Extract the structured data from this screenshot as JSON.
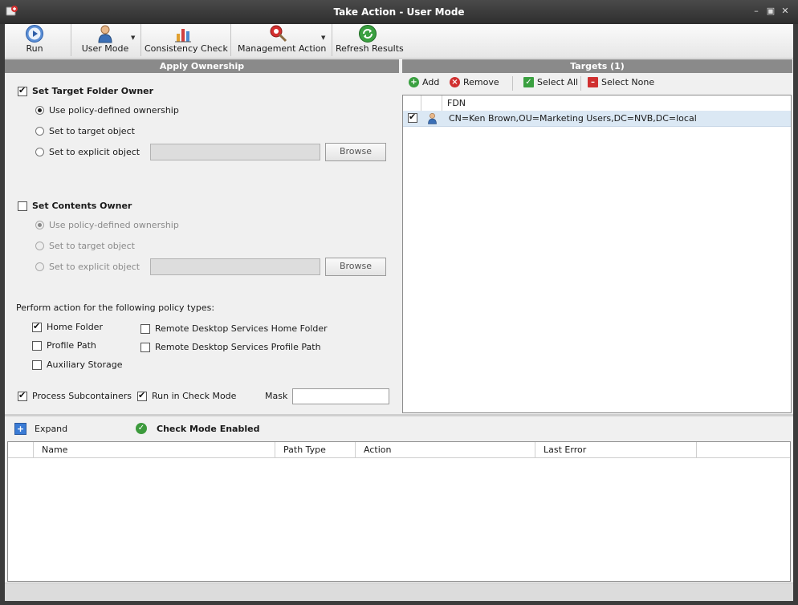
{
  "window": {
    "title": "Take Action - User Mode",
    "controls": [
      "minimize-icon",
      "restore-icon",
      "close-icon"
    ]
  },
  "toolbar": {
    "run_label": "Run",
    "user_mode_label": "User Mode",
    "consistency_check_label": "Consistency Check",
    "management_action_label": "Management Action",
    "refresh_results_label": "Refresh Results"
  },
  "apply_ownership": {
    "header": "Apply Ownership",
    "target_folder_owner": {
      "label": "Set Target Folder Owner",
      "checked": true,
      "options": [
        "Use policy-defined ownership",
        "Set to target object",
        "Set to explicit object"
      ],
      "selected": 0,
      "browse_label": "Browse",
      "explicit_value": ""
    },
    "contents_owner": {
      "label": "Set Contents Owner",
      "checked": false,
      "options": [
        "Use policy-defined ownership",
        "Set to target object",
        "Set to explicit object"
      ],
      "selected": 0,
      "browse_label": "Browse",
      "explicit_value": ""
    },
    "policy_types_label": "Perform action for the following policy types:",
    "policy_types": [
      {
        "label": "Home Folder",
        "checked": true
      },
      {
        "label": "Remote Desktop Services Home Folder",
        "checked": false
      },
      {
        "label": "Profile Path",
        "checked": false
      },
      {
        "label": "Remote Desktop Services Profile Path",
        "checked": false
      },
      {
        "label": "Auxiliary Storage",
        "checked": false
      }
    ],
    "process_subcontainers": {
      "label": "Process Subcontainers",
      "checked": true
    },
    "run_in_check_mode": {
      "label": "Run in Check Mode",
      "checked": true
    },
    "mask_label": "Mask",
    "mask_value": ""
  },
  "targets": {
    "header": "Targets  (1)",
    "add_label": "Add",
    "remove_label": "Remove",
    "select_all_label": "Select All",
    "select_none_label": "Select None",
    "columns": [
      "",
      "",
      "FDN"
    ],
    "rows": [
      {
        "checked": true,
        "icon": "user-icon",
        "fdn": "CN=Ken Brown,OU=Marketing Users,DC=NVB,DC=local"
      }
    ]
  },
  "results": {
    "expand_label": "Expand",
    "check_mode_label": "Check Mode Enabled",
    "columns": [
      "",
      "Name",
      "Path Type",
      "Action",
      "Last Error"
    ],
    "rows": []
  },
  "colors": {
    "titlebar": "#2e2e2e",
    "section_header": "#8a8a8a",
    "selected_row": "#dbe8f4",
    "accent_green": "#3c9a3c",
    "accent_red": "#d03030"
  }
}
